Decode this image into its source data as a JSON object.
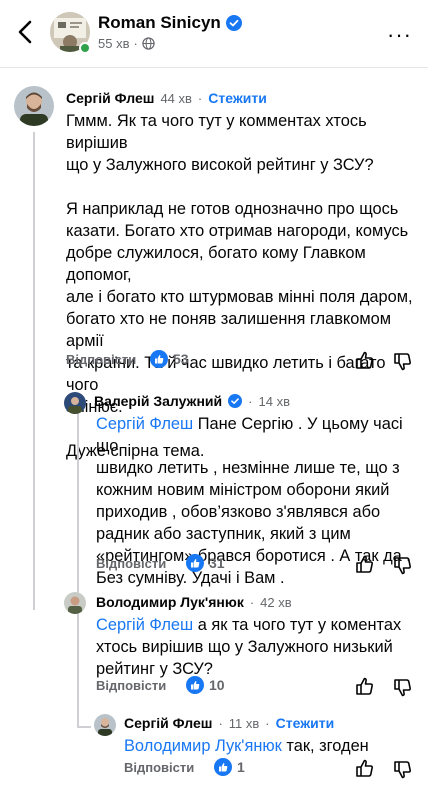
{
  "header": {
    "name": "Roman Sinicyn",
    "time": "55 хв",
    "more": "···"
  },
  "comments": [
    {
      "author": "Сергій Флеш",
      "time": "44 хв",
      "sep": "·",
      "follow": "Стежити",
      "text": "Гммм. Як та чого тут у комментах хтось вирішив\nщо у Залужного високой рейтинг у ЗСУ?\n\nЯ наприклад не готов однозначно про щось\nказати. Богато хто отримав нагороди, комусь\nдобре служилося, богато кому Главком допомог,\nале і богато кто штурмовав мінні поля даром,\nбогато хто не поняв залишення главкомом армії\nта країни. Та й час швидко летить і багато чого\nзмінює.\n\nДуже спірна тема.",
      "reply": "Відповісти",
      "likes": "53"
    },
    {
      "author": "Валерій Залужний",
      "time": "14 хв",
      "sep": "·",
      "mention": "Сергій Флеш",
      "text": " Пане Сергію . У цьому часі що\nшвидко летить , незмінне лише те, що з\nкожним новим міністром оборони який\nприходив , обов’язково з'являвся або\nрадник або заступник, який з цим\n«рейтингом» брався боротися . А так да .\nБез сумніву. Удачі і Вам .",
      "reply": "Відповісти",
      "likes": "31"
    },
    {
      "author": "Володимир Лук'янюк",
      "time": "42 хв",
      "sep": "·",
      "mention": "Сергій Флеш",
      "text": " а як та чого тут у коментах\nхтось вирішив що у Залужного низький\nрейтинг у ЗСУ?",
      "reply": "Відповісти",
      "likes": "10"
    },
    {
      "author": "Сергій Флеш",
      "time": "11 хв",
      "sep": "·",
      "follow": "Стежити",
      "mention": "Володимир Лук'янюк",
      "text": " так, згоден",
      "reply": "Відповісти",
      "likes": "1"
    }
  ]
}
